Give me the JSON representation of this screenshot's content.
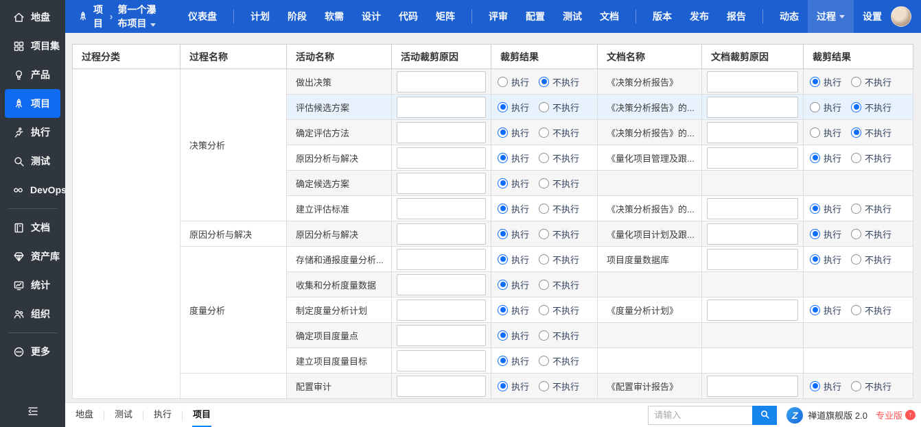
{
  "sidebar": {
    "items": [
      {
        "key": "home",
        "label": "地盘",
        "icon": "home-icon"
      },
      {
        "key": "project-set",
        "label": "项目集",
        "icon": "project-set-icon"
      },
      {
        "key": "product",
        "label": "产品",
        "icon": "product-icon"
      },
      {
        "key": "project",
        "label": "项目",
        "icon": "rocket-icon",
        "active": true
      },
      {
        "key": "execution",
        "label": "执行",
        "icon": "execution-icon"
      },
      {
        "key": "test",
        "label": "测试",
        "icon": "test-icon"
      },
      {
        "key": "devops",
        "label": "DevOps",
        "icon": "devops-icon",
        "divider_after": true
      },
      {
        "key": "doc",
        "label": "文档",
        "icon": "doc-icon"
      },
      {
        "key": "asset",
        "label": "资产库",
        "icon": "asset-icon"
      },
      {
        "key": "stats",
        "label": "统计",
        "icon": "stats-icon"
      },
      {
        "key": "org",
        "label": "组织",
        "icon": "org-icon",
        "divider_after": true
      },
      {
        "key": "more",
        "label": "更多",
        "icon": "more-icon"
      }
    ]
  },
  "topnav": {
    "app_label": "项目",
    "project_name": "第一个瀑布项目",
    "groups": [
      {
        "items": [
          {
            "key": "dashboard",
            "label": "仪表盘"
          }
        ]
      },
      {
        "items": [
          {
            "key": "plan",
            "label": "计划"
          },
          {
            "key": "stage",
            "label": "阶段"
          },
          {
            "key": "softreq",
            "label": "软需"
          },
          {
            "key": "design",
            "label": "设计"
          },
          {
            "key": "code",
            "label": "代码"
          },
          {
            "key": "matrix",
            "label": "矩阵"
          }
        ]
      },
      {
        "items": [
          {
            "key": "review",
            "label": "评审"
          },
          {
            "key": "config",
            "label": "配置"
          },
          {
            "key": "test",
            "label": "测试"
          },
          {
            "key": "doc",
            "label": "文档"
          }
        ]
      },
      {
        "items": [
          {
            "key": "build",
            "label": "版本"
          },
          {
            "key": "release",
            "label": "发布"
          },
          {
            "key": "report",
            "label": "报告"
          }
        ]
      },
      {
        "items": [
          {
            "key": "dynamic",
            "label": "动态"
          },
          {
            "key": "process",
            "label": "过程",
            "active": true,
            "caret": true
          },
          {
            "key": "setting",
            "label": "设置"
          }
        ]
      }
    ]
  },
  "table": {
    "headers": [
      "过程分类",
      "过程名称",
      "活动名称",
      "活动裁剪原因",
      "裁剪结果",
      "文档名称",
      "文档裁剪原因",
      "裁剪结果"
    ],
    "radio_labels": {
      "execute": "执行",
      "skip": "不执行"
    },
    "rows": [
      {
        "process": "决策分析",
        "process_rowspan": 6,
        "activity": "做出决策",
        "activity_result": "skip",
        "doc": "《决策分析报告》",
        "doc_result": "execute"
      },
      {
        "activity": "评估候选方案",
        "activity_result": "execute",
        "doc": "《决策分析报告》的...",
        "doc_result": "skip",
        "selected": true
      },
      {
        "activity": "确定评估方法",
        "activity_result": "execute",
        "doc": "《决策分析报告》的...",
        "doc_result": "skip"
      },
      {
        "activity": "原因分析与解决",
        "activity_result": "execute",
        "doc": "《量化项目管理及跟...",
        "doc_result": "execute"
      },
      {
        "activity": "确定候选方案",
        "activity_result": "execute",
        "doc": "",
        "doc_result": null
      },
      {
        "activity": "建立评估标准",
        "activity_result": "execute",
        "doc": "《决策分析报告》的...",
        "doc_result": "execute"
      },
      {
        "process": "原因分析与解决",
        "process_rowspan": 1,
        "activity": "原因分析与解决",
        "activity_result": "execute",
        "doc": "《量化项目计划及跟...",
        "doc_result": "execute"
      },
      {
        "process": "度量分析",
        "process_rowspan": 5,
        "activity": "存储和通报度量分析...",
        "activity_result": "execute",
        "doc": "项目度量数据库",
        "doc_result": "execute"
      },
      {
        "activity": "收集和分析度量数据",
        "activity_result": "execute",
        "doc": "",
        "doc_result": null
      },
      {
        "activity": "制定度量分析计划",
        "activity_result": "execute",
        "doc": "《度量分析计划》",
        "doc_result": "execute"
      },
      {
        "activity": "确定项目度量点",
        "activity_result": "execute",
        "doc": "",
        "doc_result": null
      },
      {
        "activity": "建立项目度量目标",
        "activity_result": "execute",
        "doc": "",
        "doc_result": null
      },
      {
        "process": "",
        "process_rowspan": 1,
        "activity": "配置审计",
        "activity_result": "execute",
        "doc": "《配置审计报告》",
        "doc_result": "execute"
      }
    ]
  },
  "footer": {
    "tabs": [
      {
        "key": "home",
        "label": "地盘"
      },
      {
        "key": "test",
        "label": "测试"
      },
      {
        "key": "execution",
        "label": "执行"
      },
      {
        "key": "project",
        "label": "项目",
        "active": true
      }
    ],
    "search_placeholder": "请输入",
    "brand": "禅道旗舰版 2.0",
    "edition": "专业版"
  },
  "colors": {
    "topbar_blue": "#1c5fd0",
    "sidebar_bg": "#30363d",
    "sidebar_active_blue": "#0f6bf2",
    "accent_blue": "#0d6efd",
    "selected_row_blue": "#e7f2fd",
    "footer_underline_blue": "#0d84ff",
    "edition_red": "#ff5555"
  }
}
